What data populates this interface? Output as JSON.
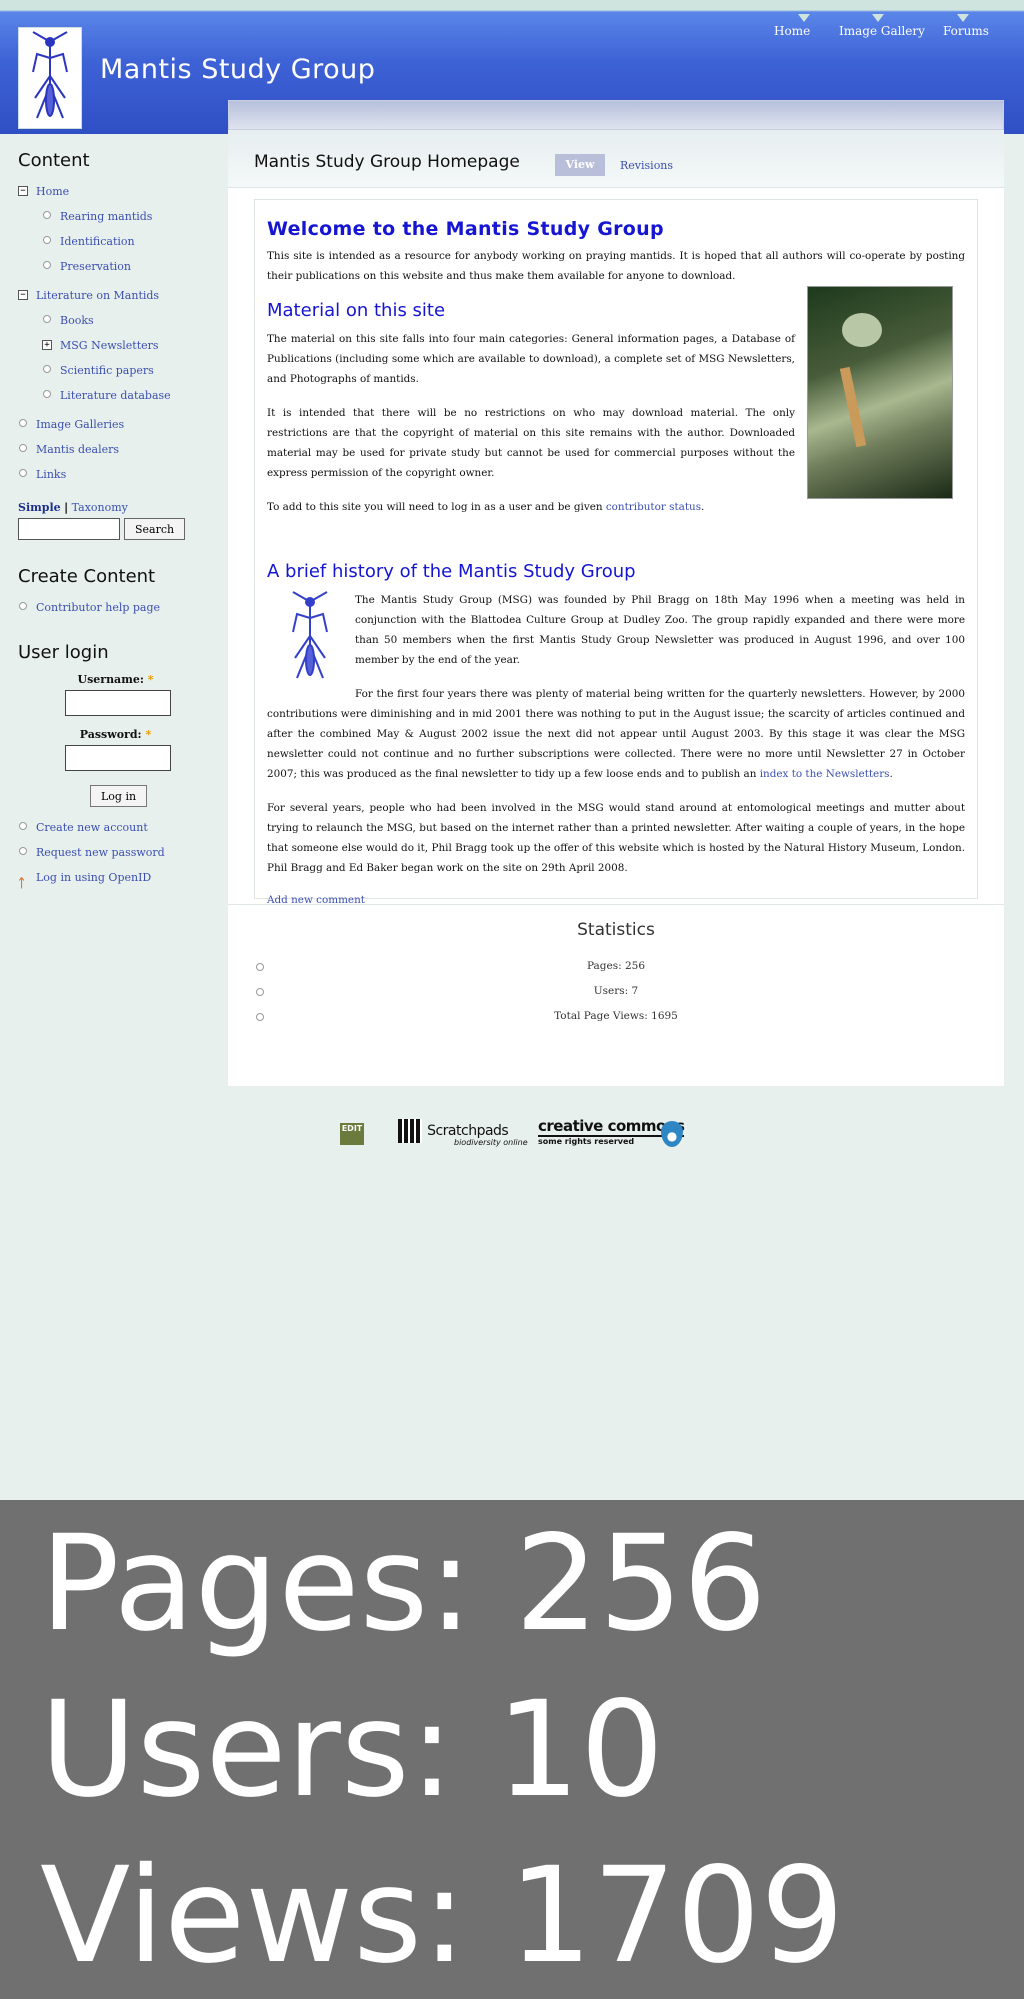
{
  "header": {
    "site_name": "Mantis Study Group",
    "nav": [
      "Home",
      "Image Gallery",
      "Forums"
    ]
  },
  "sidebar": {
    "content_title": "Content",
    "menu": [
      {
        "label": "Home",
        "level": 0,
        "marker": "minus"
      },
      {
        "label": "Rearing mantids",
        "level": 1,
        "marker": "bullet"
      },
      {
        "label": "Identification",
        "level": 1,
        "marker": "bullet"
      },
      {
        "label": "Preservation",
        "level": 1,
        "marker": "bullet"
      },
      {
        "label": "Literature on Mantids",
        "level": 0,
        "marker": "minus"
      },
      {
        "label": "Books",
        "level": 1,
        "marker": "bullet"
      },
      {
        "label": "MSG Newsletters",
        "level": 1,
        "marker": "plus"
      },
      {
        "label": "Scientific papers",
        "level": 1,
        "marker": "bullet"
      },
      {
        "label": "Literature database",
        "level": 1,
        "marker": "bullet"
      },
      {
        "label": "Image Galleries",
        "level": 0,
        "marker": "bullet"
      },
      {
        "label": "Mantis dealers",
        "level": 0,
        "marker": "bullet"
      },
      {
        "label": "Links",
        "level": 0,
        "marker": "bullet"
      }
    ],
    "search": {
      "tab_simple": "Simple",
      "separator": "|",
      "tab_taxonomy": "Taxonomy",
      "button": "Search"
    },
    "create_title": "Create Content",
    "create_items": [
      "Contributor help page"
    ],
    "login": {
      "title": "User login",
      "username_label": "Username:",
      "password_label": "Password:",
      "required_mark": "*",
      "button": "Log in",
      "links": [
        "Create new account",
        "Request new password",
        "Log in using OpenID"
      ]
    }
  },
  "main": {
    "page_title": "Mantis Study Group Homepage",
    "tab_view": "View",
    "tab_revisions": "Revisions",
    "welcome_heading": "Welcome to the Mantis Study Group",
    "intro": "This site is intended as a resource for anybody working on praying mantids.  It is hoped that all authors will co-operate by posting their publications on this website and thus make them available for anyone to download.",
    "material_heading": "Material on this site",
    "material_p1": "The material on this site falls into four main categories: General information pages, a Database of Publications (including some which are available to download), a complete set of MSG Newsletters, and Photographs of mantids.",
    "material_p2": "It is intended that there will be no restrictions on who may download material.   The only restrictions are that the copyright of material on this site remains with the author.   Downloaded material may be used for private study but cannot be used for commercial purposes without the express permission of the copyright owner.",
    "material_p3_before": "To add to this site you will need to log in as a user and be given ",
    "material_p3_link": "contributor status",
    "material_p3_after": ".",
    "history_heading": "A brief history of the Mantis Study Group",
    "history_p1": "The Mantis Study Group (MSG) was founded by Phil Bragg on 18th May 1996 when a meeting was held in conjunction with the Blattodea Culture Group at Dudley Zoo.  The group rapidly expanded and there were more than 50 members when the first Mantis Study Group Newsletter was produced in August 1996, and over 100 member by the end of the year.",
    "history_p2_before": "For the first four years there was plenty of material being written for the quarterly newsletters.  However, by 2000 contributions were diminishing and in mid 2001 there was nothing to put in the August issue; the scarcity of articles continued and after the combined May & August 2002 issue the next did not appear until August 2003.  By this stage it was clear the MSG newsletter could not continue and no further subscriptions were collected.  There were no more until Newsletter 27 in October 2007; this was produced as the final newsletter to tidy up a few loose ends and to publish an ",
    "history_p2_link": "index to the Newsletters",
    "history_p2_after": ".",
    "history_p3": "For several years, people who had been involved in the MSG would stand around at entomological meetings and mutter about trying to relaunch the MSG, but based on the internet rather than a printed newsletter.    After waiting a couple of years, in the hope that someone else would do it, Phil Bragg took up the offer of this website which is hosted by the Natural History Museum, London.  Phil Bragg and Ed Baker began work on the site on 29th April 2008.",
    "add_comment": "Add new comment"
  },
  "stats": {
    "title": "Statistics",
    "items": [
      "Pages: 256",
      "Users: 7",
      "Total Page Views: 1695"
    ]
  },
  "footer": {
    "edit_logo": "EDIT",
    "scratchpads": "Scratchpads",
    "scratchpads_tag": "biodiversity online",
    "cc": "creative commons",
    "cc_tag": "some rights reserved",
    "drupal_icon": "drupal-icon"
  },
  "overlay": {
    "line1": "Pages: 256",
    "line2": "Users: 10",
    "line3": "Views: 1709"
  },
  "colors": {
    "header_blue": "#3e63d6",
    "heading_blue": "#1515d2",
    "link_blue": "#3a4fb0",
    "overlay_gray": "#6f706f"
  }
}
